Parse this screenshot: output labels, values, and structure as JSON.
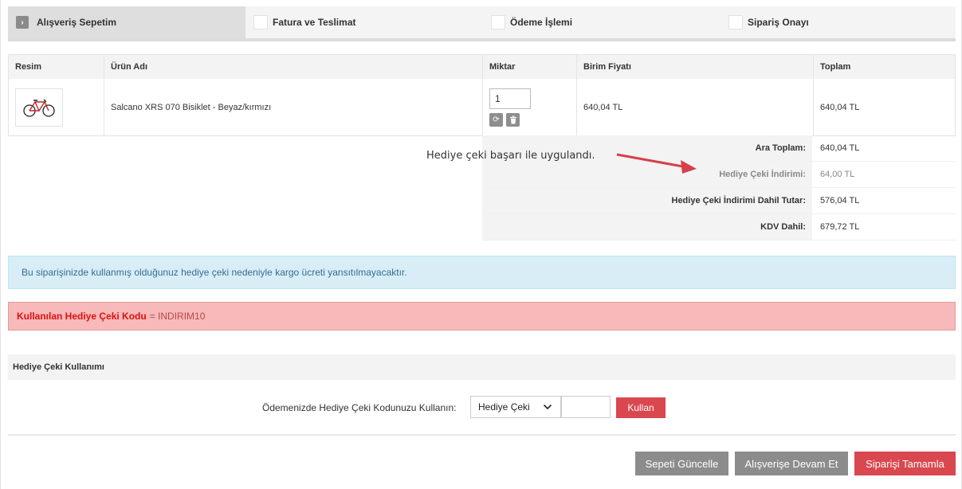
{
  "steps": [
    {
      "label": "Alışveriş Sepetim",
      "active": true
    },
    {
      "label": "Fatura ve Teslimat",
      "active": false
    },
    {
      "label": "Ödeme İşlemi",
      "active": false
    },
    {
      "label": "Sipariş Onayı",
      "active": false
    }
  ],
  "cart": {
    "headers": {
      "image": "Resim",
      "name": "Ürün Adı",
      "qty": "Miktar",
      "unit_price": "Birim Fiyatı",
      "total": "Toplam"
    },
    "item": {
      "name": "Salcano XRS 070 Bisiklet - Beyaz/kırmızı",
      "qty": "1",
      "unit_price": "640,04 TL",
      "total": "640,04 TL",
      "icon": "bicycle-icon"
    }
  },
  "totals": [
    {
      "label": "Ara Toplam:",
      "value": "640,04 TL"
    },
    {
      "label": "Hediye Çeki İndirimi:",
      "value": "64,00 TL"
    },
    {
      "label": "Hediye Çeki İndirimi Dahil Tutar:",
      "value": "576,04 TL"
    },
    {
      "label": "KDV Dahil:",
      "value": "679,72 TL"
    }
  ],
  "note": "Hediye çeki başarı ile uygulandı.",
  "info_alert": "Bu siparişinizde kullanmış olduğunuz hediye çeki nedeniyle kargo ücreti yansıtılmayacaktır.",
  "code_alert": {
    "label": "Kullanılan Hediye Çeki Kodu",
    "value": "= INDIRIM10"
  },
  "gift": {
    "title": "Hediye Çeki Kullanımı",
    "prompt": "Ödemenizde Hediye Çeki Kodunuzu Kullanın:",
    "select_value": "Hediye Çeki",
    "apply_label": "Kullan"
  },
  "buttons": {
    "update": "Sepeti Güncelle",
    "continue": "Alışverişe Devam Et",
    "complete": "Siparişi Tamamla"
  },
  "colors": {
    "accent_red": "#d9474f",
    "gray_button": "#8c8c8c",
    "info_bg": "#d9edf7",
    "danger_bg": "#f7b9b9"
  }
}
